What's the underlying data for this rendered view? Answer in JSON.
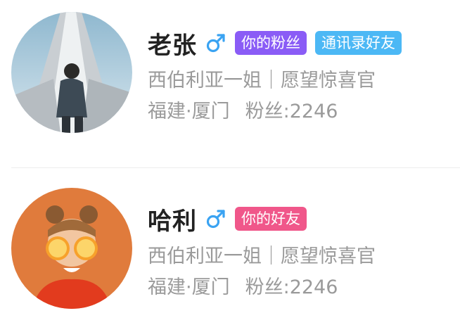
{
  "colors": {
    "gender_male": "#3aa3f2",
    "tag_fan": "#8a5cf6",
    "tag_contact": "#4cb8f5",
    "tag_friend": "#f0578a",
    "secondary_text": "#9a9a9a"
  },
  "users": [
    {
      "name": "老张",
      "gender_icon": "male-icon",
      "tags": [
        {
          "label": "你的粉丝",
          "color": "#8a5cf6"
        },
        {
          "label": "通讯录好友",
          "color": "#4cb8f5"
        }
      ],
      "bio": "西伯利亚一姐｜愿望惊喜官",
      "location": "福建·厦门",
      "fans": "粉丝:2246"
    },
    {
      "name": "哈利",
      "gender_icon": "male-icon",
      "tags": [
        {
          "label": "你的好友",
          "color": "#f0578a"
        }
      ],
      "bio": "西伯利亚一姐｜愿望惊喜官",
      "location": "福建·厦门",
      "fans": "粉丝:2246"
    }
  ]
}
